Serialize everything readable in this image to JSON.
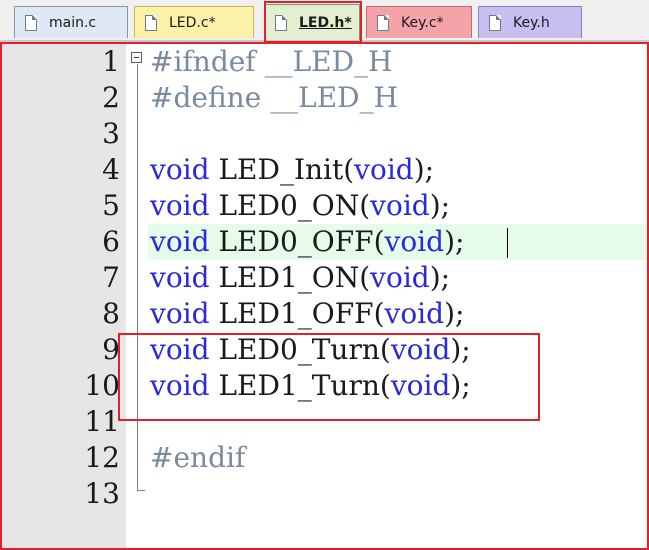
{
  "tabs": [
    {
      "label": "main.c"
    },
    {
      "label": "LED.c*"
    },
    {
      "label": "LED.h*"
    },
    {
      "label": "Key.c*"
    },
    {
      "label": "Key.h"
    }
  ],
  "editor": {
    "line_numbers": [
      "1",
      "2",
      "3",
      "4",
      "5",
      "6",
      "7",
      "8",
      "9",
      "10",
      "11",
      "12",
      "13"
    ],
    "lines": [
      {
        "pre": "#ifndef __LED_H"
      },
      {
        "pre": "#define __LED_H"
      },
      {
        "pre": ""
      },
      {
        "kw1": "void",
        "name": " LED_Init(",
        "kw2": "void",
        "tail": ");"
      },
      {
        "kw1": "void",
        "name": " LED0_ON(",
        "kw2": "void",
        "tail": ");"
      },
      {
        "kw1": "void",
        "name": " LED0_OFF(",
        "kw2": "void",
        "tail": ");"
      },
      {
        "kw1": "void",
        "name": " LED1_ON(",
        "kw2": "void",
        "tail": ");"
      },
      {
        "kw1": "void",
        "name": " LED1_OFF(",
        "kw2": "void",
        "tail": ");"
      },
      {
        "kw1": "void",
        "name": " LED0_Turn(",
        "kw2": "void",
        "tail": ");"
      },
      {
        "kw1": "void",
        "name": " LED1_Turn(",
        "kw2": "void",
        "tail": ");"
      },
      {
        "pre": ""
      },
      {
        "pre": "#endif"
      },
      {
        "pre": ""
      }
    ]
  },
  "colors": {
    "keyword": "#2a2ad8",
    "preprocessor": "#7a8aa0",
    "annotation": "#e0202a",
    "current_line": "#e6fbea"
  }
}
